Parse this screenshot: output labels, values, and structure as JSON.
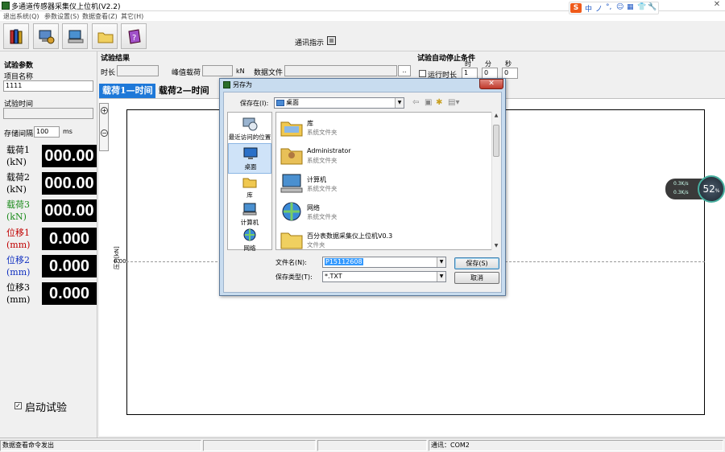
{
  "window": {
    "title": "多通道传感器采集仪上位机(V2.2)",
    "close_glyph": "✕"
  },
  "menu": [
    "退出系统(Q)",
    "参数设置(S)",
    "数据查看(Z)",
    "其它(H)"
  ],
  "ime": {
    "logo": "S",
    "mode": "中",
    "symbols": [
      "ノ",
      "°,",
      "☺",
      "▦",
      "👕",
      "🔧"
    ]
  },
  "toolbar": {
    "buttons": [
      {
        "icon": "books-icon"
      },
      {
        "icon": "settings-computer-icon"
      },
      {
        "icon": "computer-icon"
      },
      {
        "icon": "folder-icon"
      },
      {
        "icon": "help-book-icon"
      }
    ],
    "comm_indicator_label": "通讯指示"
  },
  "params": {
    "title": "试验参数",
    "project_name_label": "项目名称",
    "project_name": "1111",
    "test_time_label": "试验时间",
    "test_time": "",
    "interval_label": "存储间隔",
    "interval": "100",
    "interval_unit": "ms"
  },
  "readings": [
    {
      "label": "载荷1",
      "unit": "(kN)",
      "value": "000.00",
      "color": "#000000"
    },
    {
      "label": "载荷2",
      "unit": "(kN)",
      "value": "000.00",
      "color": "#000000"
    },
    {
      "label": "载荷3",
      "unit": "(kN)",
      "value": "000.00",
      "color": "#1a8a1a"
    },
    {
      "label": "位移1",
      "unit": "(mm)",
      "value": "0.000",
      "color": "#c00000"
    },
    {
      "label": "位移2",
      "unit": "(mm)",
      "value": "0.000",
      "color": "#1030c0"
    },
    {
      "label": "位移3",
      "unit": "(mm)",
      "value": "0.000",
      "color": "#000000"
    }
  ],
  "start": {
    "checked_glyph": "✓",
    "label": "启动试验"
  },
  "results": {
    "title": "试验结果",
    "duration_label": "时长",
    "duration": "",
    "peak_label": "峰值载荷",
    "peak": "",
    "peak_unit": "kN",
    "datafile_label": "数据文件",
    "datafile": "",
    "browse_label": ".."
  },
  "stop": {
    "title": "试验自动停止条件",
    "runtime_label": "运行时长",
    "hour_label": "时",
    "minute_label": "分",
    "second_label": "秒",
    "hours": "1",
    "minutes": "0",
    "seconds": "0"
  },
  "tabs": [
    "载荷1—时间",
    "载荷2—时间"
  ],
  "chart": {
    "y_label": "压力[kN]",
    "y_zero": "0.00",
    "zoom_in": "+",
    "zoom_out": "−"
  },
  "net_widget": {
    "up": "0.3K/s",
    "down": "0.3K/s",
    "percent": "52",
    "percent_unit": "%"
  },
  "status": {
    "message": "数据查看命令发出",
    "pane2": "",
    "pane3": "",
    "comm": "通讯：COM2"
  },
  "dialog": {
    "title": "另存为",
    "close_glyph": "✕",
    "save_in_label": "保存在(I):",
    "save_in_value": "桌面",
    "places": [
      {
        "label": "最近访问的位置",
        "icon": "recent-places-icon"
      },
      {
        "label": "桌面",
        "icon": "desktop-icon"
      },
      {
        "label": "库",
        "icon": "libraries-icon"
      },
      {
        "label": "计算机",
        "icon": "computer-icon"
      },
      {
        "label": "网络",
        "icon": "network-icon"
      }
    ],
    "files": [
      {
        "name": "库",
        "type": "系统文件夹",
        "icon": "libraries-icon"
      },
      {
        "name": "Administrator",
        "type": "系统文件夹",
        "icon": "user-folder-icon"
      },
      {
        "name": "计算机",
        "type": "系统文件夹",
        "icon": "computer-icon"
      },
      {
        "name": "网络",
        "type": "系统文件夹",
        "icon": "network-icon"
      },
      {
        "name": "百分表数据采集仪上位机V0.3",
        "type": "文件夹",
        "icon": "folder-icon"
      }
    ],
    "filename_label": "文件名(N):",
    "filename_value": "P15112608",
    "filetype_label": "保存类型(T):",
    "filetype_value": "*.TXT",
    "save_button": "保存(S)",
    "cancel_button": "取消"
  },
  "colors": {
    "display_bg": "#000000",
    "display_fg": "#ffffff",
    "tab_active": "#1e78d8",
    "selection": "#3399ff"
  }
}
